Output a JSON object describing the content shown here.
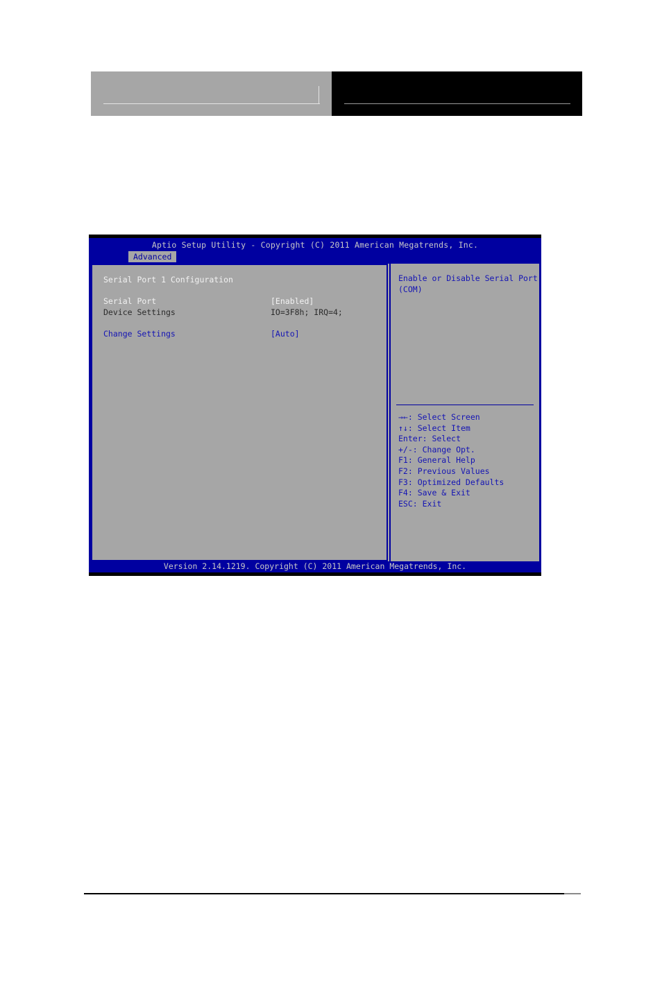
{
  "page": {
    "header": {
      "left_block_name": "masthead-left",
      "right_block_name": "masthead-right"
    }
  },
  "bios": {
    "title": "Aptio Setup Utility - Copyright (C) 2011 American Megatrends, Inc.",
    "tabs": [
      {
        "label": "Advanced",
        "active": true
      }
    ],
    "section_title": "Serial Port 1 Configuration",
    "settings": [
      {
        "label": "Serial Port",
        "value": "[Enabled]",
        "label_color": "white",
        "value_color": "white"
      },
      {
        "label": "Device Settings",
        "value": "IO=3F8h; IRQ=4;",
        "label_color": "dim",
        "value_color": "dim"
      },
      {
        "label": "Change Settings",
        "value": "[Auto]",
        "label_color": "blue",
        "value_color": "blue"
      }
    ],
    "help": [
      "Enable or Disable Serial Port",
      "(COM)"
    ],
    "nav_keys": [
      "→←: Select Screen",
      "↑↓: Select Item",
      "Enter: Select",
      "+/-: Change Opt.",
      "F1: General Help",
      "F2: Previous Values",
      "F3: Optimized Defaults",
      "F4: Save & Exit",
      "ESC: Exit"
    ],
    "footer": "Version 2.14.1219. Copyright (C) 2011 American Megatrends, Inc.",
    "colors": {
      "screen_blue": "#0000a0",
      "panel_gray": "#a6a6a6",
      "text_white": "#f2f2f2",
      "text_dim": "#2b2b2b",
      "text_blue": "#1414b4",
      "title_text": "#c8c8c8"
    }
  }
}
